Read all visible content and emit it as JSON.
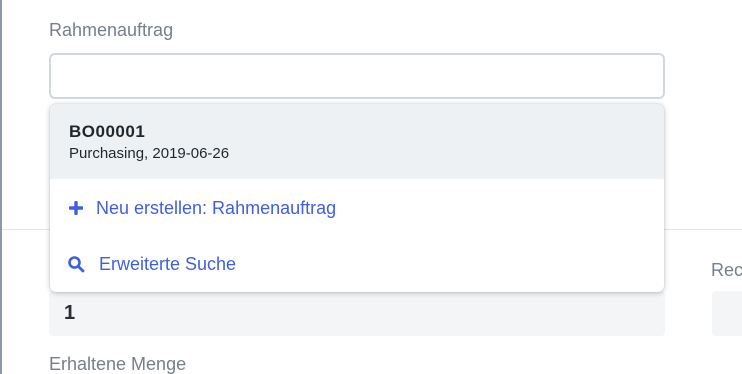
{
  "form": {
    "rahmenauftrag_label": "Rahmenauftrag",
    "rahmenauftrag_value": "",
    "right_column_label_partial": "Rec",
    "quantity_value": "1",
    "erhaltene_menge_label": "Erhaltene Menge"
  },
  "dropdown": {
    "record": {
      "title": "BO00001",
      "subtitle": "Purchasing, 2019-06-26"
    },
    "create_label": "Neu erstellen: Rahmenauftrag",
    "search_label": "Erweiterte Suche"
  },
  "colors": {
    "accent": "#3f5fe0",
    "label": "#74808b",
    "highlight_row": "#eef1f3",
    "readonly_bg": "#f3f5f7",
    "input_border": "#d1d8dd"
  },
  "icons": {
    "create": "plus-icon",
    "search": "search-icon"
  }
}
